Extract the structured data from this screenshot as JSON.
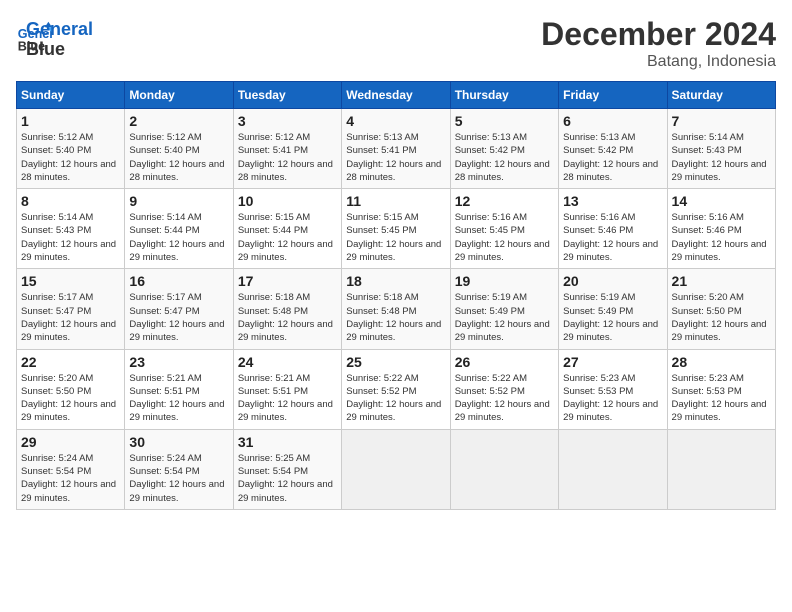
{
  "logo": {
    "line1": "General",
    "line2": "Blue"
  },
  "header": {
    "month": "December 2024",
    "location": "Batang, Indonesia"
  },
  "weekdays": [
    "Sunday",
    "Monday",
    "Tuesday",
    "Wednesday",
    "Thursday",
    "Friday",
    "Saturday"
  ],
  "weeks": [
    [
      {
        "day": "1",
        "sunrise": "5:12 AM",
        "sunset": "5:40 PM",
        "daylight": "12 hours and 28 minutes."
      },
      {
        "day": "2",
        "sunrise": "5:12 AM",
        "sunset": "5:40 PM",
        "daylight": "12 hours and 28 minutes."
      },
      {
        "day": "3",
        "sunrise": "5:12 AM",
        "sunset": "5:41 PM",
        "daylight": "12 hours and 28 minutes."
      },
      {
        "day": "4",
        "sunrise": "5:13 AM",
        "sunset": "5:41 PM",
        "daylight": "12 hours and 28 minutes."
      },
      {
        "day": "5",
        "sunrise": "5:13 AM",
        "sunset": "5:42 PM",
        "daylight": "12 hours and 28 minutes."
      },
      {
        "day": "6",
        "sunrise": "5:13 AM",
        "sunset": "5:42 PM",
        "daylight": "12 hours and 28 minutes."
      },
      {
        "day": "7",
        "sunrise": "5:14 AM",
        "sunset": "5:43 PM",
        "daylight": "12 hours and 29 minutes."
      }
    ],
    [
      {
        "day": "8",
        "sunrise": "5:14 AM",
        "sunset": "5:43 PM",
        "daylight": "12 hours and 29 minutes."
      },
      {
        "day": "9",
        "sunrise": "5:14 AM",
        "sunset": "5:44 PM",
        "daylight": "12 hours and 29 minutes."
      },
      {
        "day": "10",
        "sunrise": "5:15 AM",
        "sunset": "5:44 PM",
        "daylight": "12 hours and 29 minutes."
      },
      {
        "day": "11",
        "sunrise": "5:15 AM",
        "sunset": "5:45 PM",
        "daylight": "12 hours and 29 minutes."
      },
      {
        "day": "12",
        "sunrise": "5:16 AM",
        "sunset": "5:45 PM",
        "daylight": "12 hours and 29 minutes."
      },
      {
        "day": "13",
        "sunrise": "5:16 AM",
        "sunset": "5:46 PM",
        "daylight": "12 hours and 29 minutes."
      },
      {
        "day": "14",
        "sunrise": "5:16 AM",
        "sunset": "5:46 PM",
        "daylight": "12 hours and 29 minutes."
      }
    ],
    [
      {
        "day": "15",
        "sunrise": "5:17 AM",
        "sunset": "5:47 PM",
        "daylight": "12 hours and 29 minutes."
      },
      {
        "day": "16",
        "sunrise": "5:17 AM",
        "sunset": "5:47 PM",
        "daylight": "12 hours and 29 minutes."
      },
      {
        "day": "17",
        "sunrise": "5:18 AM",
        "sunset": "5:48 PM",
        "daylight": "12 hours and 29 minutes."
      },
      {
        "day": "18",
        "sunrise": "5:18 AM",
        "sunset": "5:48 PM",
        "daylight": "12 hours and 29 minutes."
      },
      {
        "day": "19",
        "sunrise": "5:19 AM",
        "sunset": "5:49 PM",
        "daylight": "12 hours and 29 minutes."
      },
      {
        "day": "20",
        "sunrise": "5:19 AM",
        "sunset": "5:49 PM",
        "daylight": "12 hours and 29 minutes."
      },
      {
        "day": "21",
        "sunrise": "5:20 AM",
        "sunset": "5:50 PM",
        "daylight": "12 hours and 29 minutes."
      }
    ],
    [
      {
        "day": "22",
        "sunrise": "5:20 AM",
        "sunset": "5:50 PM",
        "daylight": "12 hours and 29 minutes."
      },
      {
        "day": "23",
        "sunrise": "5:21 AM",
        "sunset": "5:51 PM",
        "daylight": "12 hours and 29 minutes."
      },
      {
        "day": "24",
        "sunrise": "5:21 AM",
        "sunset": "5:51 PM",
        "daylight": "12 hours and 29 minutes."
      },
      {
        "day": "25",
        "sunrise": "5:22 AM",
        "sunset": "5:52 PM",
        "daylight": "12 hours and 29 minutes."
      },
      {
        "day": "26",
        "sunrise": "5:22 AM",
        "sunset": "5:52 PM",
        "daylight": "12 hours and 29 minutes."
      },
      {
        "day": "27",
        "sunrise": "5:23 AM",
        "sunset": "5:53 PM",
        "daylight": "12 hours and 29 minutes."
      },
      {
        "day": "28",
        "sunrise": "5:23 AM",
        "sunset": "5:53 PM",
        "daylight": "12 hours and 29 minutes."
      }
    ],
    [
      {
        "day": "29",
        "sunrise": "5:24 AM",
        "sunset": "5:54 PM",
        "daylight": "12 hours and 29 minutes."
      },
      {
        "day": "30",
        "sunrise": "5:24 AM",
        "sunset": "5:54 PM",
        "daylight": "12 hours and 29 minutes."
      },
      {
        "day": "31",
        "sunrise": "5:25 AM",
        "sunset": "5:54 PM",
        "daylight": "12 hours and 29 minutes."
      },
      null,
      null,
      null,
      null
    ]
  ],
  "labels": {
    "sunrise": "Sunrise:",
    "sunset": "Sunset:",
    "daylight": "Daylight:"
  }
}
